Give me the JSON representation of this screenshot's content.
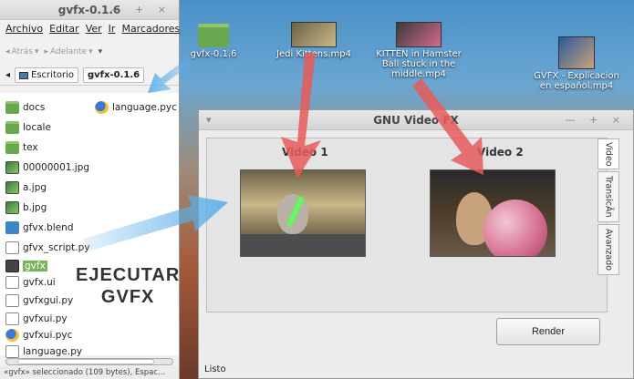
{
  "desktop": {
    "icons": [
      {
        "label": "gvfx-0.1.6",
        "kind": "folder"
      },
      {
        "label": "Jedi Kittens.mp4",
        "kind": "video"
      },
      {
        "label": "KITTEN in Hamster Ball stuck in the middle.mp4",
        "kind": "video"
      },
      {
        "label": "GVFX - Explicacion en español.mp4",
        "kind": "video"
      }
    ]
  },
  "file_manager": {
    "title": "gvfx-0.1.6",
    "window_buttons": "— + ×",
    "menu": [
      "Archivo",
      "Editar",
      "Ver",
      "Ir",
      "Marcadores"
    ],
    "toolbar": {
      "back": "Atrás",
      "forward": "Adelante"
    },
    "path": [
      "Escritorio",
      "gvfx-0.1.6"
    ],
    "files": [
      {
        "name": "docs",
        "icon": "folder-icon"
      },
      {
        "name": "language.pyc",
        "icon": "python-icon"
      },
      {
        "name": "locale",
        "icon": "folder-icon"
      },
      {
        "name": "tex",
        "icon": "folder-icon"
      },
      {
        "name": "00000001.jpg",
        "icon": "image-icon"
      },
      {
        "name": "a.jpg",
        "icon": "image-icon"
      },
      {
        "name": "b.jpg",
        "icon": "image-icon"
      },
      {
        "name": "gfvx.blend",
        "icon": "blend-icon"
      },
      {
        "name": "gfvx_script.py",
        "icon": "script-icon"
      },
      {
        "name": "gvfx",
        "icon": "executable-icon",
        "selected": true
      },
      {
        "name": "gvfx.ui",
        "icon": "ui-file-icon"
      },
      {
        "name": "gvfxgui.py",
        "icon": "script-icon"
      },
      {
        "name": "gvfxui.py",
        "icon": "script-icon"
      },
      {
        "name": "gvfxui.pyc",
        "icon": "python-icon"
      },
      {
        "name": "language.py",
        "icon": "script-icon"
      }
    ],
    "status": "«gvfx» seleccionado (109 bytes), Espac..."
  },
  "annotation": {
    "line1": "EJECUTAR",
    "line2": "GVFX"
  },
  "video_fx": {
    "title": "GNU Video FX",
    "window_buttons": "— + ×",
    "video1_label": "Video 1",
    "video2_label": "Video 2",
    "tabs": [
      "Video",
      "TransicÃn",
      "Avanzado"
    ],
    "render_label": "Render",
    "status": "Listo"
  },
  "colors": {
    "selection": "#79b35a",
    "arrow_red": "#e85a5a",
    "arrow_blue": "#5aaee8"
  }
}
